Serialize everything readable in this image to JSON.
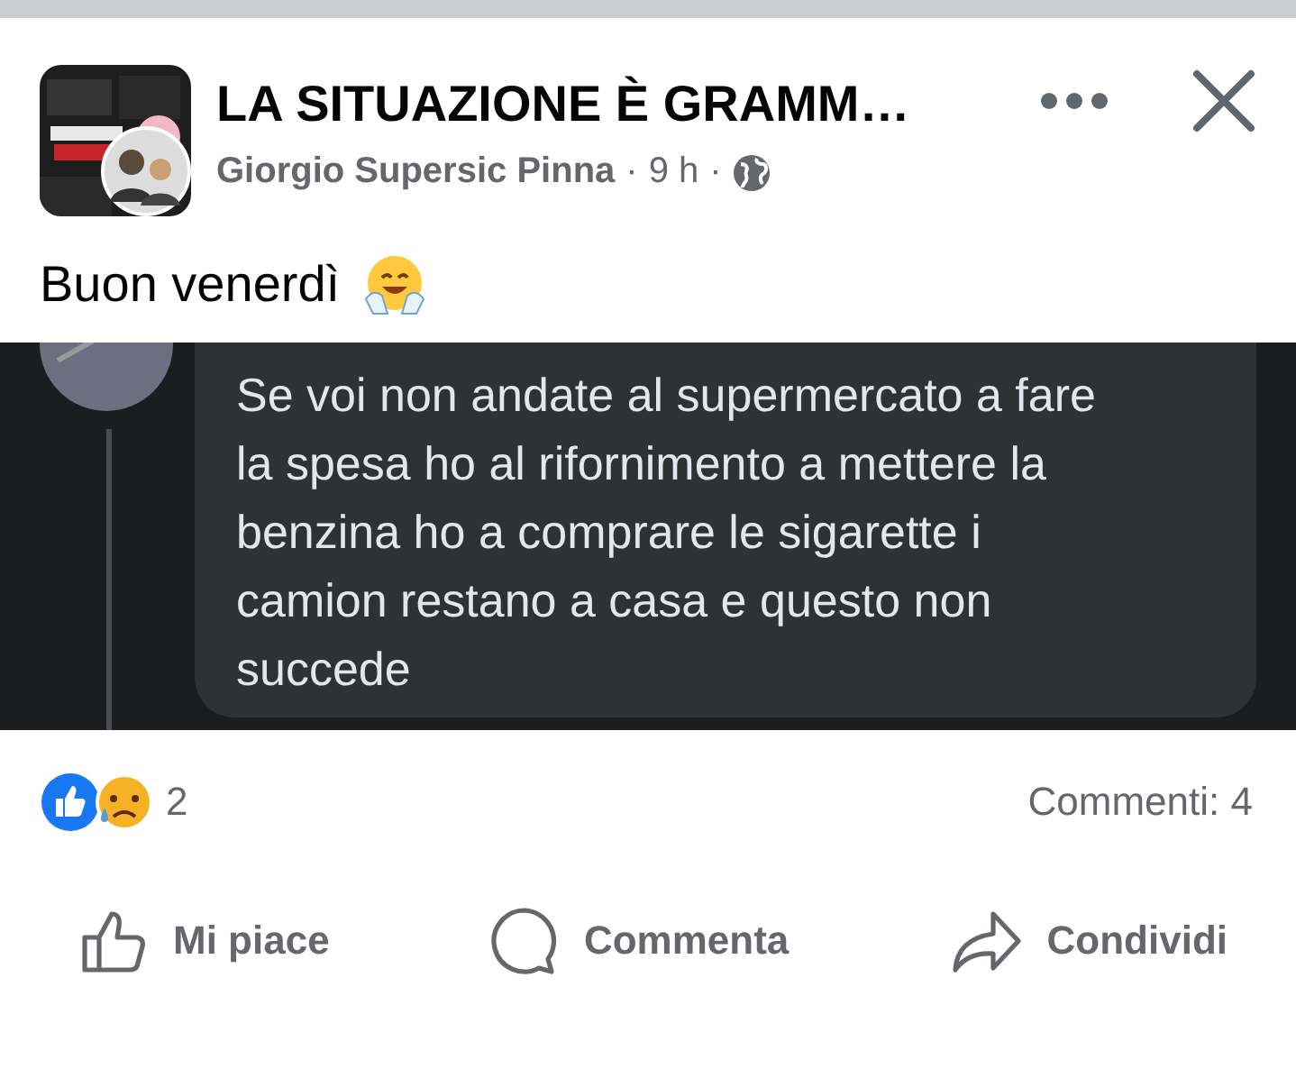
{
  "post": {
    "group_name": "LA SITUAZIONE È GRAMM…",
    "author": "Giorgio Supersic Pinna",
    "separator_1": "·",
    "time": "9 h",
    "separator_2": "·",
    "text": "Buon venerdì"
  },
  "comment_screenshot": {
    "text": "Se voi non andate al supermercato a fare la spesa ho al rifornimento a mettere la benzina ho a comprare le sigarette i camion restano a casa e questo non succede"
  },
  "reactions": {
    "count": "2",
    "comments": "Commenti: 4"
  },
  "actions": [
    {
      "kind": "like",
      "label": "Mi piace"
    },
    {
      "kind": "comment",
      "label": "Commenta"
    },
    {
      "kind": "share",
      "label": "Condividi"
    }
  ]
}
